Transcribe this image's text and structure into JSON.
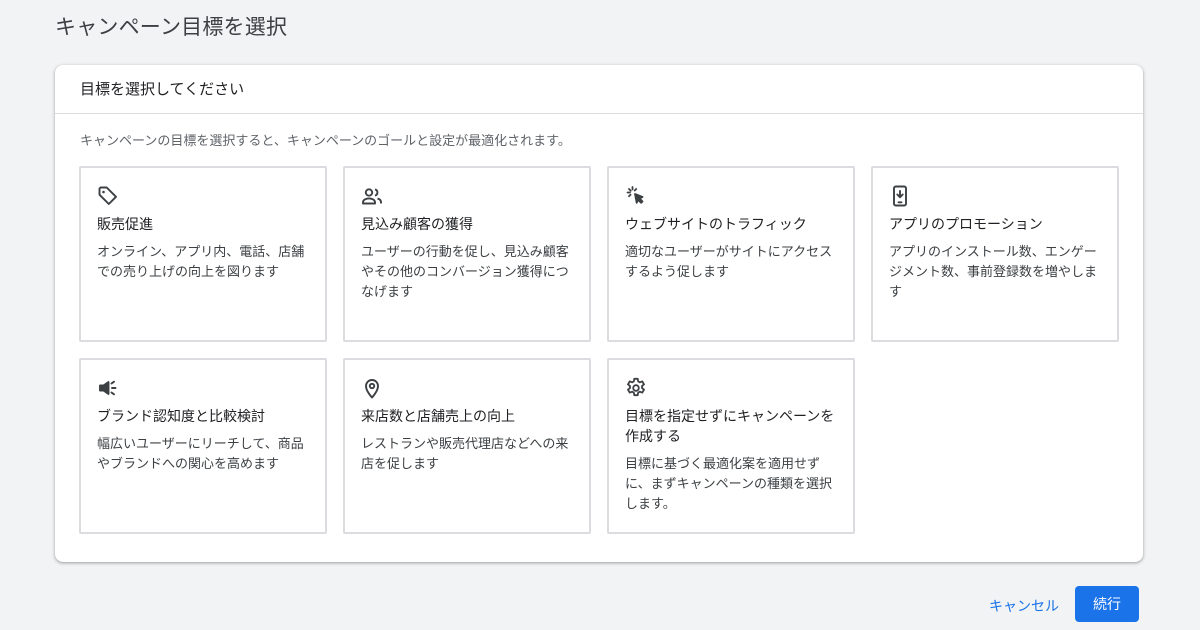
{
  "page": {
    "title": "キャンペーン目標を選択"
  },
  "panel": {
    "header": "目標を選択してください",
    "description": "キャンペーンの目標を選択すると、キャンペーンのゴールと設定が最適化されます。"
  },
  "cards": [
    {
      "icon": "tag-icon",
      "title": "販売促進",
      "description": "オンライン、アプリ内、電話、店舗での売り上げの向上を図ります"
    },
    {
      "icon": "people-icon",
      "title": "見込み顧客の獲得",
      "description": "ユーザーの行動を促し、見込み顧客やその他のコンバージョン獲得につなげます"
    },
    {
      "icon": "cursor-click-icon",
      "title": "ウェブサイトのトラフィック",
      "description": "適切なユーザーがサイトにアクセスするよう促します"
    },
    {
      "icon": "phone-download-icon",
      "title": "アプリのプロモーション",
      "description": "アプリのインストール数、エンゲージメント数、事前登録数を増やします"
    },
    {
      "icon": "megaphone-icon",
      "title": "ブランド認知度と比較検討",
      "description": "幅広いユーザーにリーチして、商品やブランドへの関心を高めます"
    },
    {
      "icon": "location-pin-icon",
      "title": "来店数と店舗売上の向上",
      "description": "レストランや販売代理店などへの来店を促します"
    },
    {
      "icon": "gear-icon",
      "title": "目標を指定せずにキャンペーンを作成する",
      "description": "目標に基づく最適化案を適用せずに、まずキャンペーンの種類を選択します。"
    }
  ],
  "footer": {
    "cancel_label": "キャンセル",
    "continue_label": "続行"
  },
  "colors": {
    "accent": "#1a73e8",
    "icon": "#3c4043",
    "border": "#dadce0",
    "background": "#f1f3f4"
  }
}
